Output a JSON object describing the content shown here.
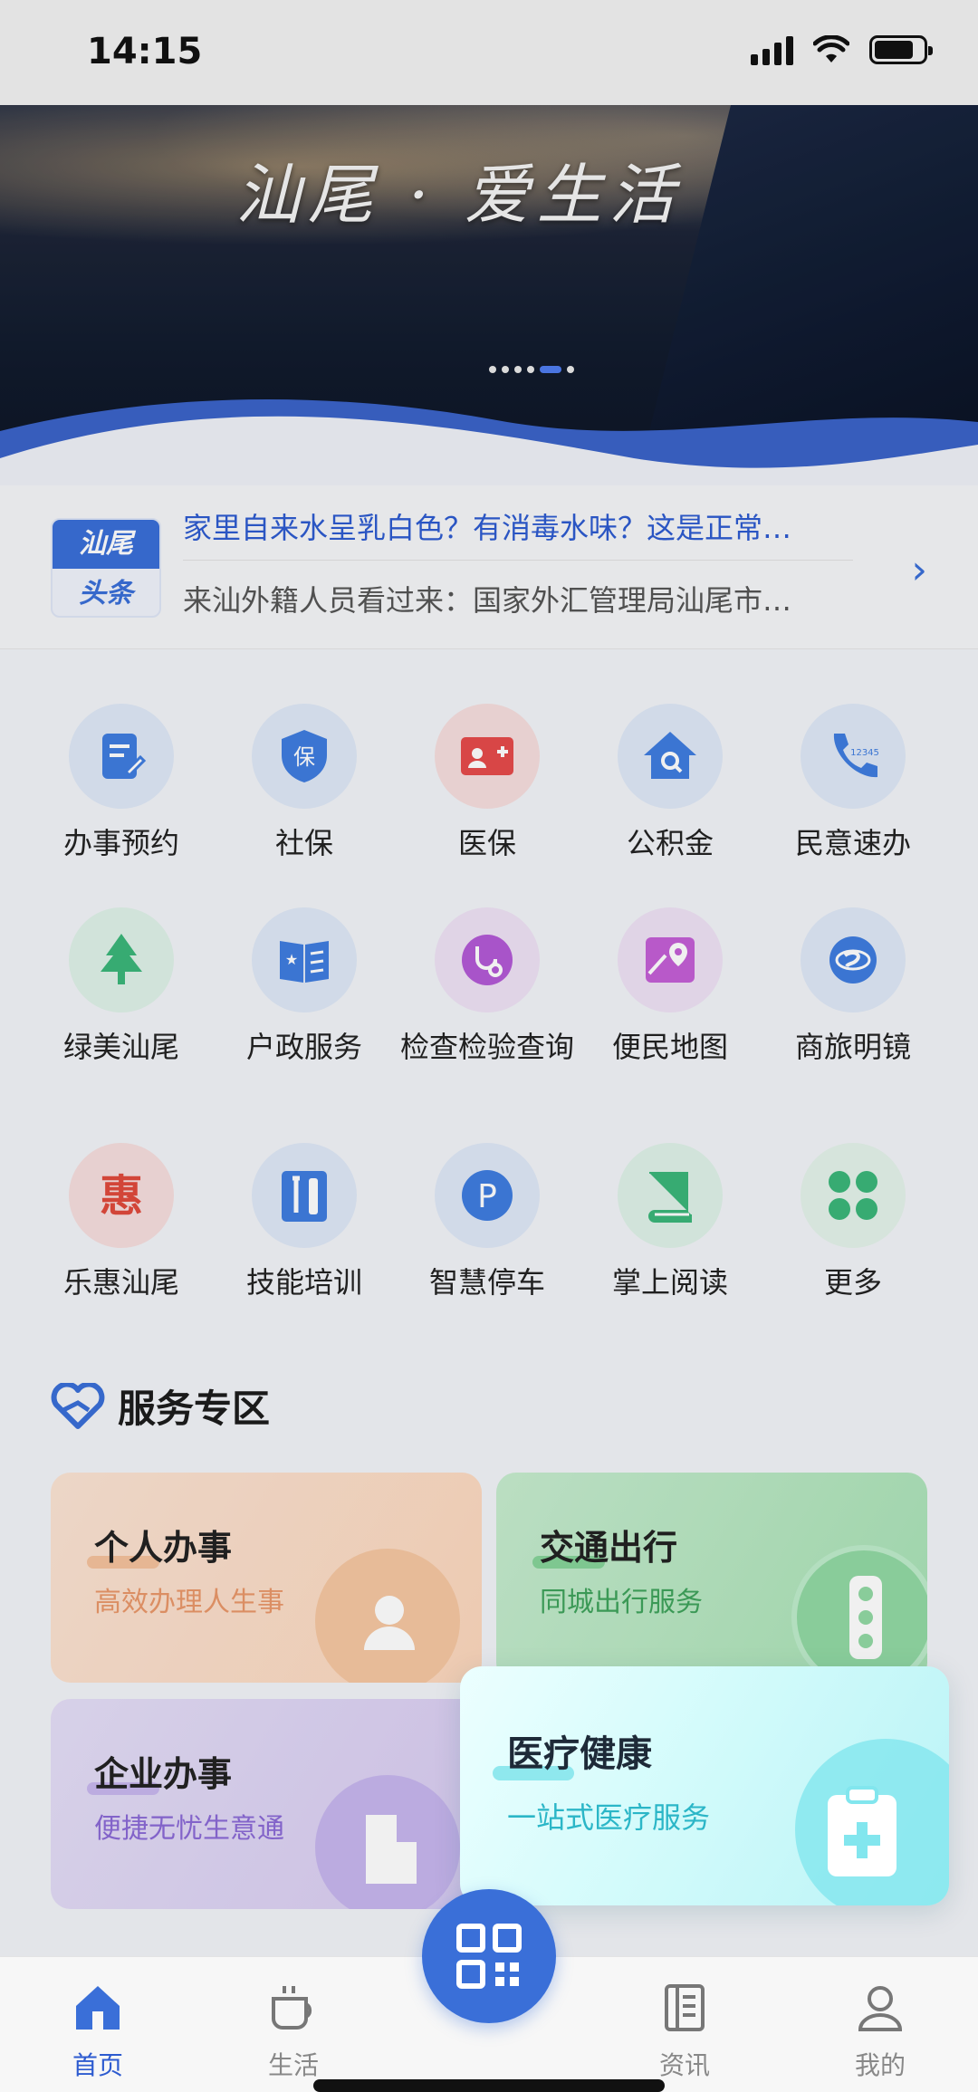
{
  "status_bar": {
    "time": "14:15"
  },
  "banner": {
    "slogan": "汕尾 · 爱生活",
    "active_dot": 4,
    "dot_count": 5
  },
  "news": {
    "badge_top": "汕尾",
    "badge_bottom": "头条",
    "headline_1": "家里自来水呈乳白色？有消毒水味？这是正常…",
    "headline_2": "来汕外籍人员看过来：国家外汇管理局汕尾市…"
  },
  "grid": {
    "items": [
      {
        "label": "办事预约",
        "icon": "edit-document-icon",
        "color": "#3f7de0",
        "bg": "#dfe8f7"
      },
      {
        "label": "社保",
        "icon": "shield-icon",
        "color": "#3f7de0",
        "bg": "#dfe8f7"
      },
      {
        "label": "医保",
        "icon": "medical-card-icon",
        "color": "#e64b4b",
        "bg": "#f6dede"
      },
      {
        "label": "公积金",
        "icon": "house-icon",
        "color": "#3f7de0",
        "bg": "#dfe8f7"
      },
      {
        "label": "民意速办",
        "icon": "phone-12345-icon",
        "color": "#3f7de0",
        "bg": "#dfe8f7",
        "icon_text": "12345"
      },
      {
        "label": "绿美汕尾",
        "icon": "tree-icon",
        "color": "#3bb67a",
        "bg": "#dff2e8"
      },
      {
        "label": "户政服务",
        "icon": "id-book-icon",
        "color": "#3f7de0",
        "bg": "#dfe8f7"
      },
      {
        "label": "检查检验查询",
        "icon": "stethoscope-icon",
        "color": "#b35ad6",
        "bg": "#efe2f5"
      },
      {
        "label": "便民地图",
        "icon": "map-pin-icon",
        "color": "#c45fd6",
        "bg": "#efe2f5"
      },
      {
        "label": "商旅明镜",
        "icon": "globe-icon",
        "color": "#3f7de0",
        "bg": "#dfe8f7"
      },
      {
        "label": "乐惠汕尾",
        "icon": "hui-character-icon",
        "color": "#e04a3c",
        "bg": "#f6dede",
        "icon_text": "惠"
      },
      {
        "label": "技能培训",
        "icon": "toolbox-icon",
        "color": "#3f7de0",
        "bg": "#dfe8f7"
      },
      {
        "label": "智慧停车",
        "icon": "parking-icon",
        "color": "#3f7de0",
        "bg": "#dfe8f7",
        "icon_text": "P"
      },
      {
        "label": "掌上阅读",
        "icon": "book-icon",
        "color": "#3bb67a",
        "bg": "#dff2e8"
      },
      {
        "label": "更多",
        "icon": "four-leaf-grid-icon",
        "color": "#3bb67a",
        "bg": "#e4f3ea"
      }
    ]
  },
  "service": {
    "title": "服务专区",
    "cards": [
      {
        "title": "个人办事",
        "subtitle": "高效办理人生事",
        "sub_color": "#e9976a"
      },
      {
        "title": "交通出行",
        "subtitle": "同城出行服务",
        "sub_color": "#3fa35c"
      },
      {
        "title": "企业办事",
        "subtitle": "便捷无忧生意通",
        "sub_color": "#8b6ad6"
      }
    ],
    "popup": {
      "title": "医疗健康",
      "subtitle": "一站式医疗服务"
    }
  },
  "nav": {
    "items": [
      {
        "label": "首页",
        "icon": "home-icon"
      },
      {
        "label": "生活",
        "icon": "coffee-cup-icon"
      },
      {
        "label": "资讯",
        "icon": "news-icon"
      },
      {
        "label": "我的",
        "icon": "user-icon"
      }
    ],
    "center_icon": "qr-code-scan-icon"
  }
}
